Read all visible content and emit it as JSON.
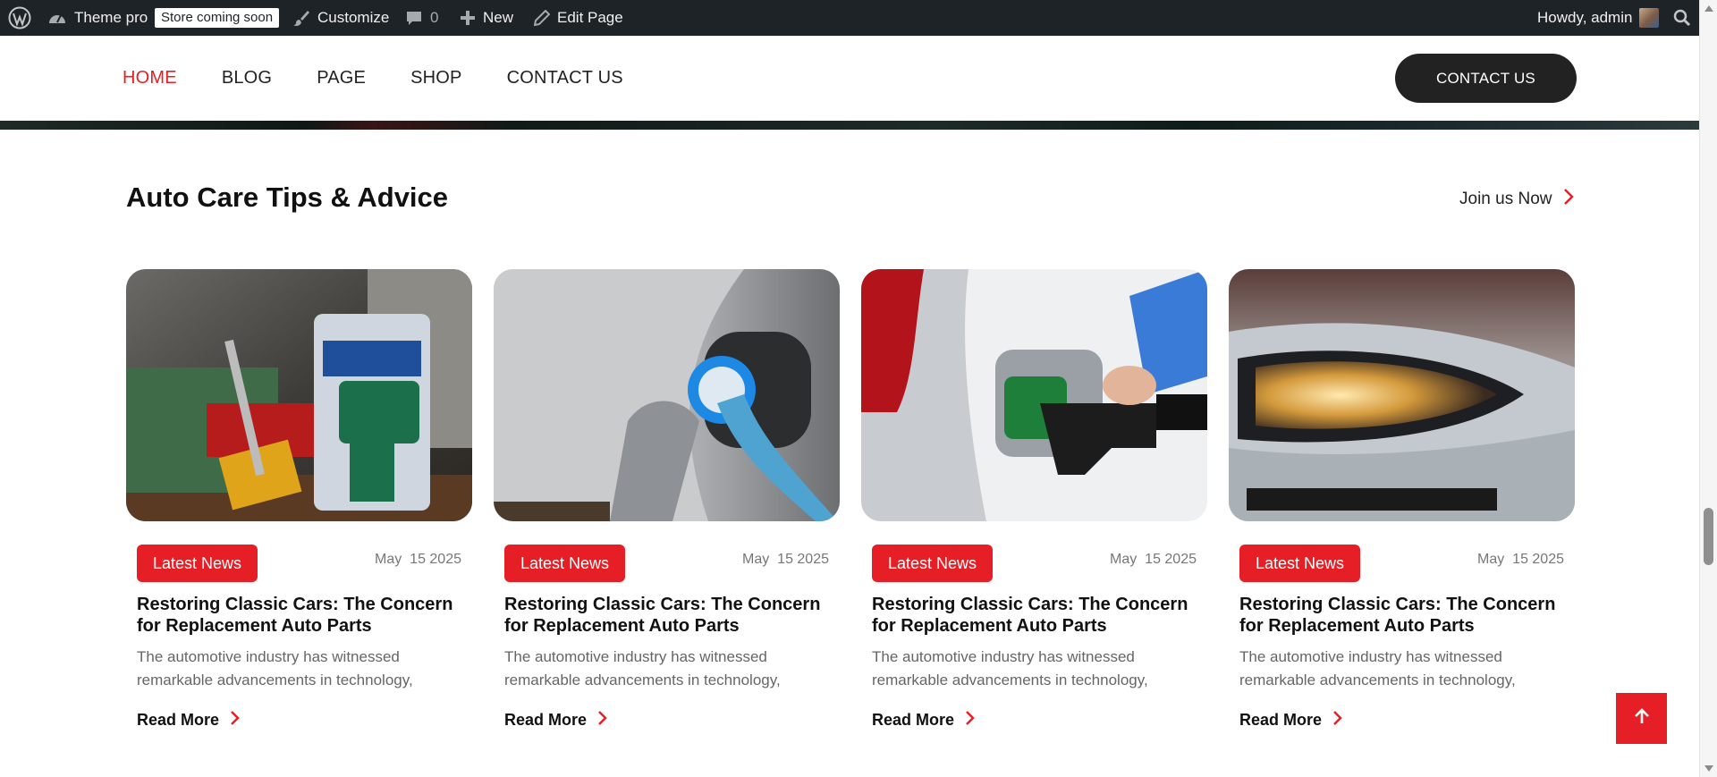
{
  "admin_bar": {
    "site_name": "Theme pro",
    "store_badge": "Store coming soon",
    "customize": "Customize",
    "comments_count": "0",
    "new_label": "New",
    "edit_page": "Edit Page",
    "greeting": "Howdy, admin"
  },
  "nav": {
    "items": [
      {
        "label": "HOME",
        "active": true
      },
      {
        "label": "BLOG",
        "active": false
      },
      {
        "label": "PAGE",
        "active": false
      },
      {
        "label": "SHOP",
        "active": false
      },
      {
        "label": "CONTACT US",
        "active": false
      }
    ],
    "contact_button": "CONTACT US"
  },
  "section": {
    "title": "Auto Care Tips & Advice",
    "join_link": "Join us Now"
  },
  "cards": [
    {
      "image": "power-tools",
      "tag": "Latest News",
      "date": "May  15 2025",
      "title": "Restoring Classic Cars: The Concern for Replacement Auto Parts",
      "excerpt": "The automotive industry has witnessed remarkable advancements in technology, design,",
      "read_more": "Read More"
    },
    {
      "image": "ev-charging-plug",
      "tag": "Latest News",
      "date": "May  15 2025",
      "title": "Restoring Classic Cars: The Concern for Replacement Auto Parts",
      "excerpt": "The automotive industry has witnessed remarkable advancements in technology, design,",
      "read_more": "Read More"
    },
    {
      "image": "fuel-nozzle",
      "tag": "Latest News",
      "date": "May  15 2025",
      "title": "Restoring Classic Cars: The Concern for Replacement Auto Parts",
      "excerpt": "The automotive industry has witnessed remarkable advancements in technology, design,",
      "read_more": "Read More"
    },
    {
      "image": "car-headlight",
      "tag": "Latest News",
      "date": "May  15 2025",
      "title": "Restoring Classic Cars: The Concern for Replacement Auto Parts",
      "excerpt": "The automotive industry has witnessed remarkable advancements in technology, design,",
      "read_more": "Read More"
    }
  ],
  "colors": {
    "accent": "#e61f26",
    "admin_bar": "#1d2327",
    "dark_button": "#222222"
  },
  "icons": {
    "admin_logo": "wordpress-logo-icon",
    "dashboard": "gauge-icon",
    "customize": "brush-icon",
    "comments": "comment-icon",
    "new": "plus-icon",
    "edit": "pencil-icon",
    "search": "search-icon",
    "chevron": "chevron-right-icon",
    "back_to_top": "arrow-up-icon"
  }
}
